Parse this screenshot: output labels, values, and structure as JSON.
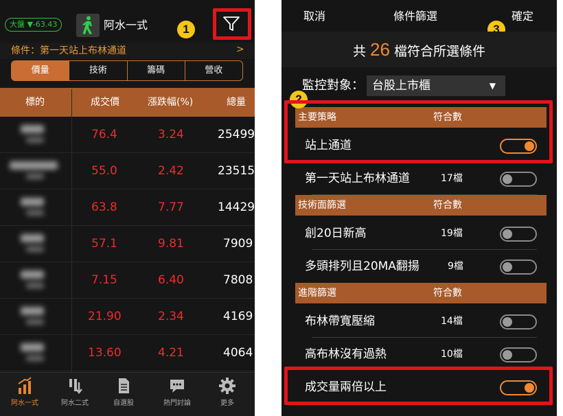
{
  "annotations": [
    "1",
    "2",
    "3"
  ],
  "left": {
    "index_badge": "大盤 ▼-63.43",
    "title": "阿水一式",
    "condition": "條件：第一天站上布林通道",
    "condition_arrow": ">",
    "tabs": [
      {
        "label": "價量",
        "active": true
      },
      {
        "label": "技術",
        "active": false
      },
      {
        "label": "籌碼",
        "active": false
      },
      {
        "label": "營收",
        "active": false
      }
    ],
    "table": {
      "headers": [
        "標的",
        "成交價",
        "漲跌幅(%)",
        "總量"
      ],
      "rows": [
        {
          "price": "76.4",
          "change": "3.24",
          "volume": "25499"
        },
        {
          "price": "55.0",
          "change": "2.42",
          "volume": "23515"
        },
        {
          "price": "63.8",
          "change": "7.77",
          "volume": "14429"
        },
        {
          "price": "57.1",
          "change": "9.81",
          "volume": "7909"
        },
        {
          "price": "7.15",
          "change": "6.40",
          "volume": "7808"
        },
        {
          "price": "21.90",
          "change": "2.34",
          "volume": "4169"
        },
        {
          "price": "13.60",
          "change": "4.21",
          "volume": "4064"
        }
      ]
    },
    "bottom_nav": [
      {
        "label": "阿水一式",
        "icon": "bar-chart-up-icon",
        "active": true
      },
      {
        "label": "阿水二式",
        "icon": "bar-chart-down-icon",
        "active": false
      },
      {
        "label": "自選股",
        "icon": "document-icon",
        "active": false
      },
      {
        "label": "熱門討論",
        "icon": "chat-bubble-icon",
        "active": false
      },
      {
        "label": "更多",
        "icon": "gear-icon",
        "active": false
      }
    ]
  },
  "right": {
    "cancel": "取消",
    "title": "條件篩選",
    "confirm": "確定",
    "count_prefix": "共",
    "count": "26",
    "count_suffix": "檔符合所選條件",
    "monitor_label": "監控對象：",
    "monitor_value": "台股上市櫃",
    "sections": [
      {
        "name": "主要策略",
        "count_header": "符合數",
        "items": [
          {
            "label": "站上通道",
            "count": "",
            "on": true
          },
          {
            "label": "第一天站上布林通道",
            "count": "17檔",
            "on": false
          }
        ]
      },
      {
        "name": "技術面篩選",
        "count_header": "符合數",
        "items": [
          {
            "label": "創20日新高",
            "count": "19檔",
            "on": false
          },
          {
            "label": "多頭排列且20MA翻揚",
            "count": "9檔",
            "on": false
          }
        ]
      },
      {
        "name": "進階篩選",
        "count_header": "符合數",
        "items": [
          {
            "label": "布林帶寬壓縮",
            "count": "14檔",
            "on": false
          },
          {
            "label": "高布林沒有過熱",
            "count": "10檔",
            "on": false
          },
          {
            "label": "成交量兩倍以上",
            "count": "",
            "on": true
          }
        ]
      }
    ]
  },
  "colors": {
    "accent": "#f08a32",
    "header_brown": "#a85a2a",
    "price_red": "#ee2b2b",
    "annotation_red": "#e4141b",
    "annotation_yellow": "#f5c518",
    "index_green": "#2fc23a"
  }
}
